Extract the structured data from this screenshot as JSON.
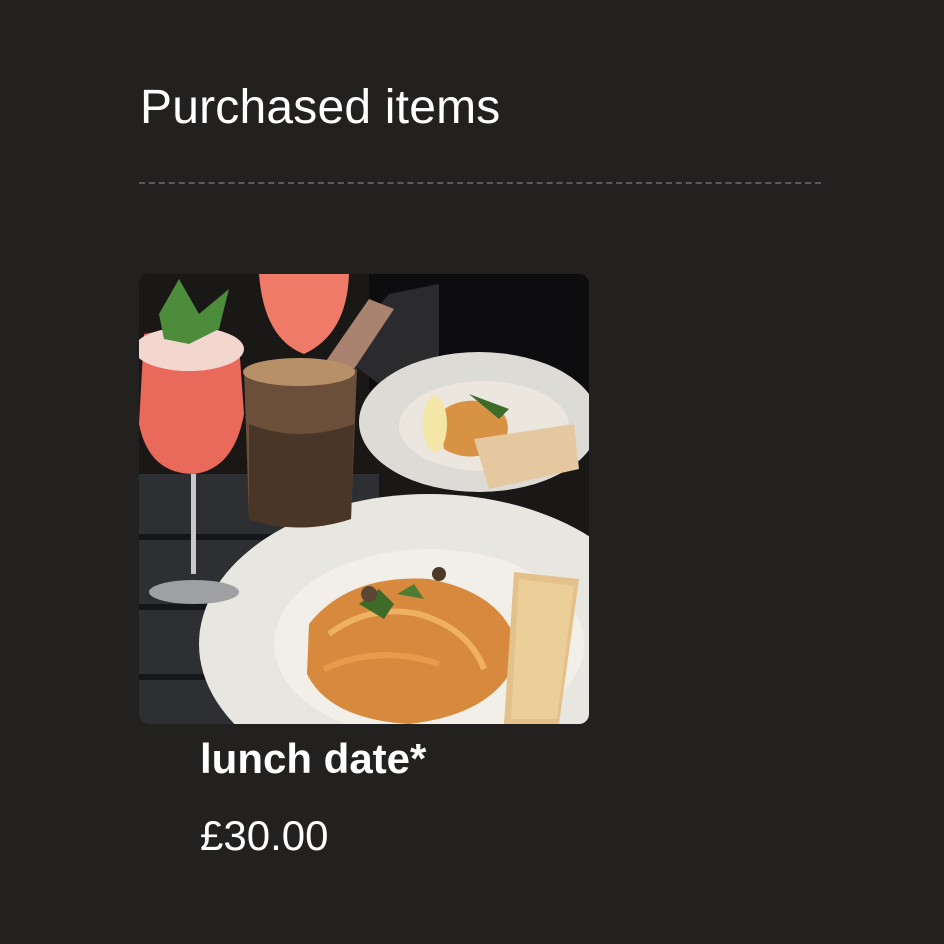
{
  "section": {
    "title": "Purchased items"
  },
  "items": [
    {
      "title": "lunch date*",
      "price": "£30.00",
      "image_description_icon": "photo-pasta-cocktails"
    }
  ],
  "colors": {
    "background": "#232120",
    "text": "#ffffff",
    "divider": "#5b5a63"
  }
}
